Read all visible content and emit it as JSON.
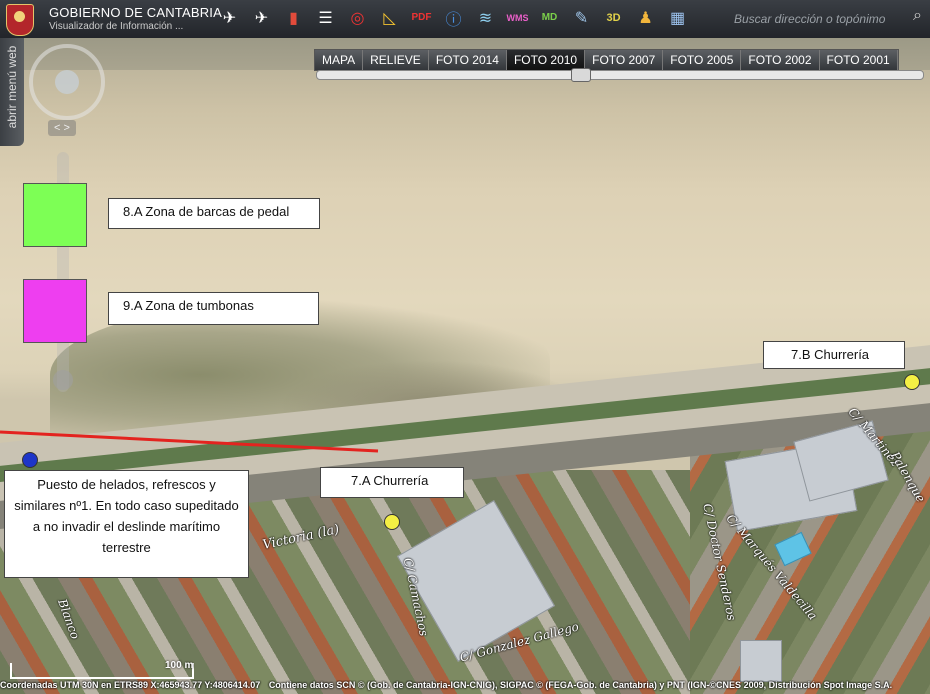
{
  "header": {
    "title": "GOBIERNO DE CANTABRIA",
    "subtitle": "Visualizador de Información ...",
    "search_placeholder": "Buscar dirección o topónimo",
    "tools": [
      "helicopter-icon",
      "helicopter2-icon",
      "book-icon",
      "list-icon",
      "target-icon",
      "ruler-icon",
      "pdf-icon",
      "info-icon",
      "layers-icon",
      "wms-icon",
      "md-icon",
      "draw-icon",
      "3d-icon",
      "person-icon",
      "calendar-icon"
    ]
  },
  "layers": {
    "tabs": [
      "MAPA",
      "RELIEVE",
      "FOTO 2014",
      "FOTO 2010",
      "FOTO 2007",
      "FOTO 2005",
      "FOTO 2002",
      "FOTO 2001"
    ],
    "active": "FOTO 2010"
  },
  "side_menu": {
    "label": "abrir menú web"
  },
  "annotations": {
    "zone_8a": "8.A Zona de barcas de pedal",
    "zone_9a": "9.A Zona de tumbonas",
    "churreria_7b": "7.B Churrería",
    "churreria_7a": "7.A Churrería",
    "helados": "Puesto de helados, refrescos y similares nº1. En todo caso supeditado a no invadir el deslinde marítimo terrestre",
    "colors": {
      "zone_8a": "#7dff55",
      "zone_9a": "#ee3ef0",
      "churreria": "#f4ef44",
      "helados": "#1d35c8",
      "line": "#e3231f"
    }
  },
  "streets": {
    "victoria": "Victoria (la)",
    "camachos": "C/ Camachos",
    "gonzalez": "C/ Gonzalez Gallego",
    "dr_senderos": "C/ Doctor Senderos",
    "marques": "C/ Marqués Valdecilla",
    "martinez": "C/ Martinez",
    "blanco": "Blanco",
    "palenque": "Palenque"
  },
  "scale": {
    "label": "100 m"
  },
  "footer": {
    "coords": "Coordenadas UTM 30N en ETRS89 X:465943.77 Y:4806414.07",
    "credits": "Contiene datos SCN © (Gob. de Cantabria-IGN-CNIG), SIGPAC © (FEGA-Gob. de Cantabria) y PNT (IGN-©CNES 2009, Distribución Spot Image S.A."
  }
}
